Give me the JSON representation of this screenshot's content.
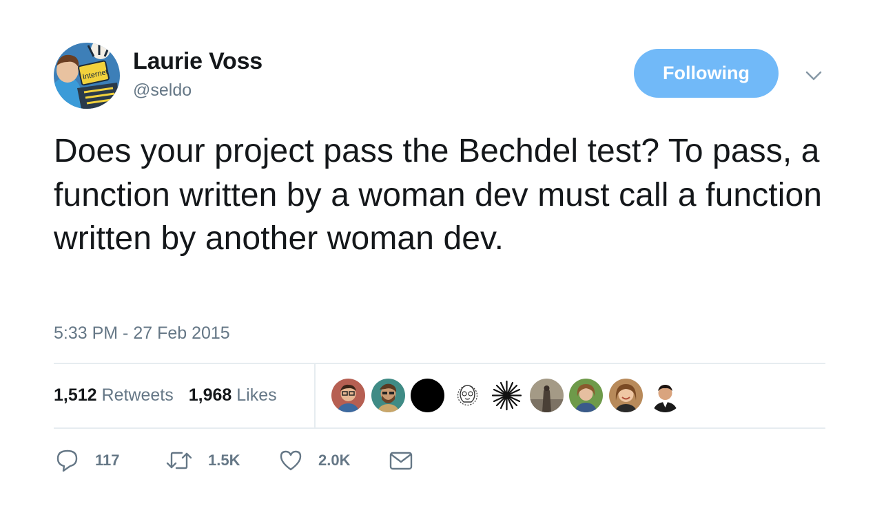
{
  "author": {
    "name": "Laurie Voss",
    "handle": "@seldo",
    "avatar_icon": "profile-photo",
    "avatar_sign_text": "Internet"
  },
  "follow_button": {
    "label": "Following"
  },
  "menu_icon": "chevron-down-icon",
  "tweet": {
    "text": "Does your project pass the Bechdel test? To pass, a function written by a woman dev must call a function written by another woman dev.",
    "timestamp": "5:33 PM - 27 Feb 2015"
  },
  "stats": {
    "retweets": {
      "count": "1,512",
      "label": "Retweets"
    },
    "likes": {
      "count": "1,968",
      "label": "Likes"
    }
  },
  "likers": [
    {
      "icon": "liker-avatar-1"
    },
    {
      "icon": "liker-avatar-2"
    },
    {
      "icon": "liker-avatar-3"
    },
    {
      "icon": "liker-avatar-4"
    },
    {
      "icon": "liker-avatar-5"
    },
    {
      "icon": "liker-avatar-6"
    },
    {
      "icon": "liker-avatar-7"
    },
    {
      "icon": "liker-avatar-8"
    },
    {
      "icon": "liker-avatar-9"
    }
  ],
  "actions": {
    "reply": {
      "icon": "reply-icon",
      "count": "117"
    },
    "retweet": {
      "icon": "retweet-icon",
      "count": "1.5K"
    },
    "like": {
      "icon": "heart-icon",
      "count": "2.0K"
    },
    "dm": {
      "icon": "envelope-icon"
    }
  },
  "colors": {
    "accent": "#71b9f8",
    "text": "#14171a",
    "secondary": "#657786",
    "divider": "#e6ecf0"
  }
}
